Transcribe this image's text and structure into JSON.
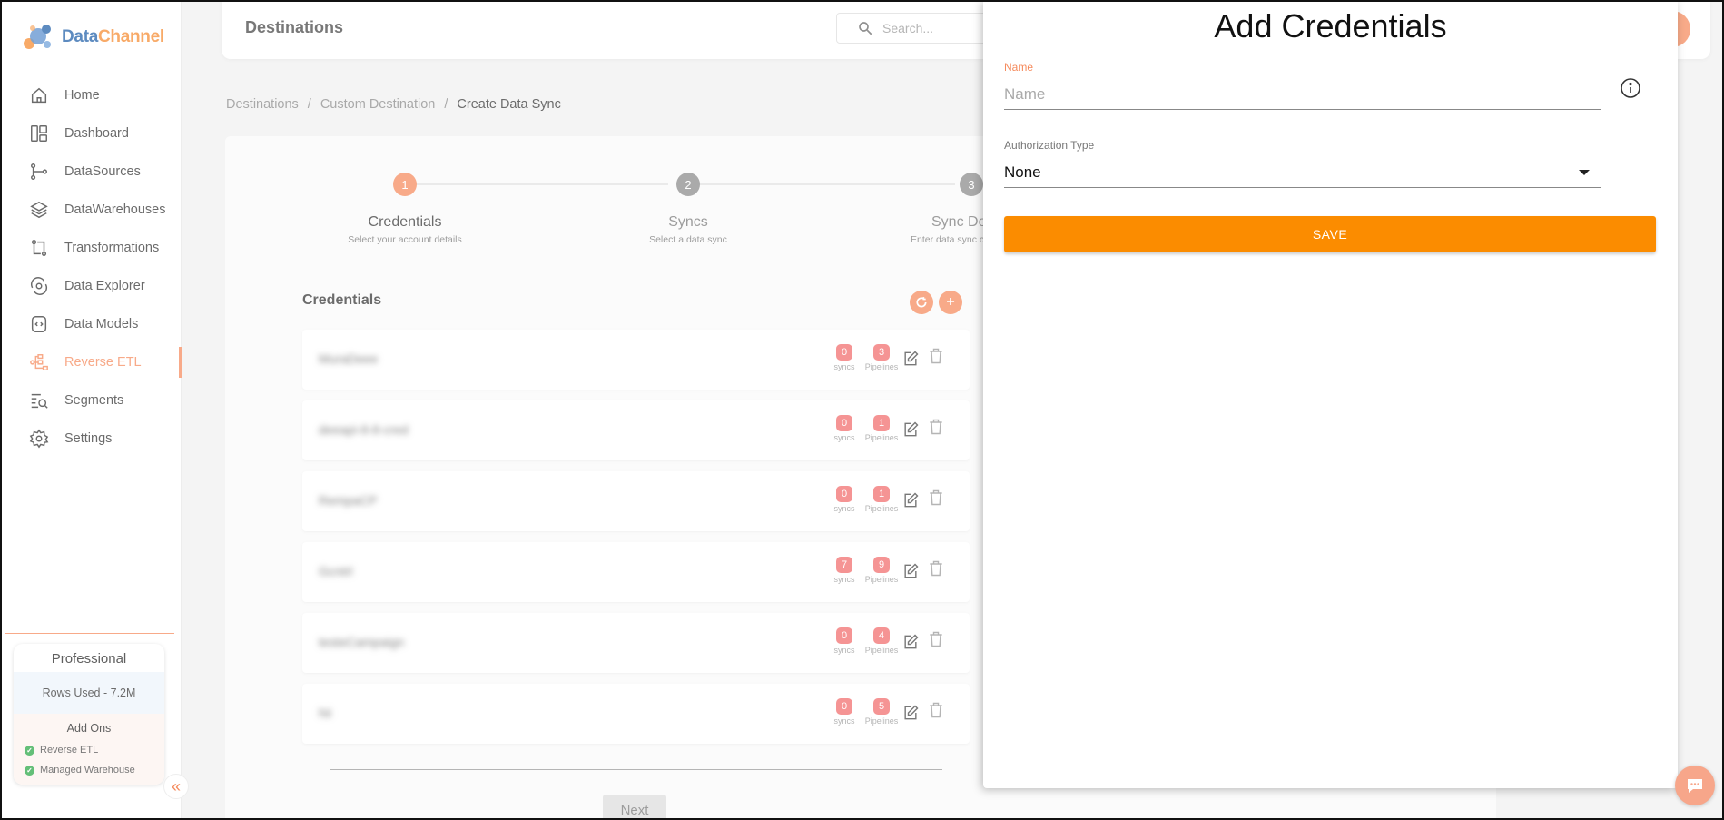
{
  "app": {
    "logo_data": "Data",
    "logo_channel": "Channel"
  },
  "sidebar": {
    "items": [
      {
        "label": "Home",
        "icon": "home-icon"
      },
      {
        "label": "Dashboard",
        "icon": "dashboard-icon"
      },
      {
        "label": "DataSources",
        "icon": "datasources-icon"
      },
      {
        "label": "DataWarehouses",
        "icon": "layers-icon"
      },
      {
        "label": "Transformations",
        "icon": "transform-icon"
      },
      {
        "label": "Data Explorer",
        "icon": "explorer-icon"
      },
      {
        "label": "Data Models",
        "icon": "models-icon"
      },
      {
        "label": "Reverse ETL",
        "icon": "reverse-etl-icon",
        "active": true
      },
      {
        "label": "Segments",
        "icon": "segments-icon"
      },
      {
        "label": "Settings",
        "icon": "gear-icon"
      }
    ],
    "plan": {
      "name": "Professional",
      "rows_used": "Rows Used - 7.2M",
      "addons_title": "Add Ons",
      "addons": [
        "Reverse ETL",
        "Managed Warehouse"
      ]
    },
    "collapse_glyph": "«"
  },
  "topbar": {
    "title": "Destinations",
    "search_placeholder": "Search..."
  },
  "breadcrumb": {
    "items": [
      "Destinations",
      "Custom Destination",
      "Create Data Sync"
    ],
    "separator": "/"
  },
  "stepper": {
    "steps": [
      {
        "number": "1",
        "label": "Credentials",
        "sub": "Select your account details",
        "state": "active"
      },
      {
        "number": "2",
        "label": "Syncs",
        "sub": "Select a data sync",
        "state": "inactive"
      },
      {
        "number": "3",
        "label": "Sync De",
        "sub": "Enter data sync c",
        "state": "inactive"
      }
    ]
  },
  "credentials": {
    "title": "Credentials",
    "add_glyph": "+",
    "syncs_label": "syncs",
    "pipelines_label": "Pipelines",
    "rows": [
      {
        "name": "MuraDeee",
        "syncs": "0",
        "pipelines": "3"
      },
      {
        "name": "deeapi-8-8-cred",
        "syncs": "0",
        "pipelines": "1"
      },
      {
        "name": "RempaCP",
        "syncs": "0",
        "pipelines": "1"
      },
      {
        "name": "Gcntrl",
        "syncs": "7",
        "pipelines": "9"
      },
      {
        "name": "testeCampaign",
        "syncs": "0",
        "pipelines": "4"
      },
      {
        "name": "hii",
        "syncs": "0",
        "pipelines": "5"
      }
    ],
    "next_label": "Next"
  },
  "drawer": {
    "title": "Add Credentials",
    "name_label": "Name",
    "name_placeholder": "Name",
    "auth_label": "Authorization Type",
    "auth_value": "None",
    "save_label": "SAVE"
  },
  "colors": {
    "accent": "#f58a5c",
    "save": "#fb8c00",
    "badge": "#f26b6b",
    "brand_blue": "#1f5fa8"
  }
}
